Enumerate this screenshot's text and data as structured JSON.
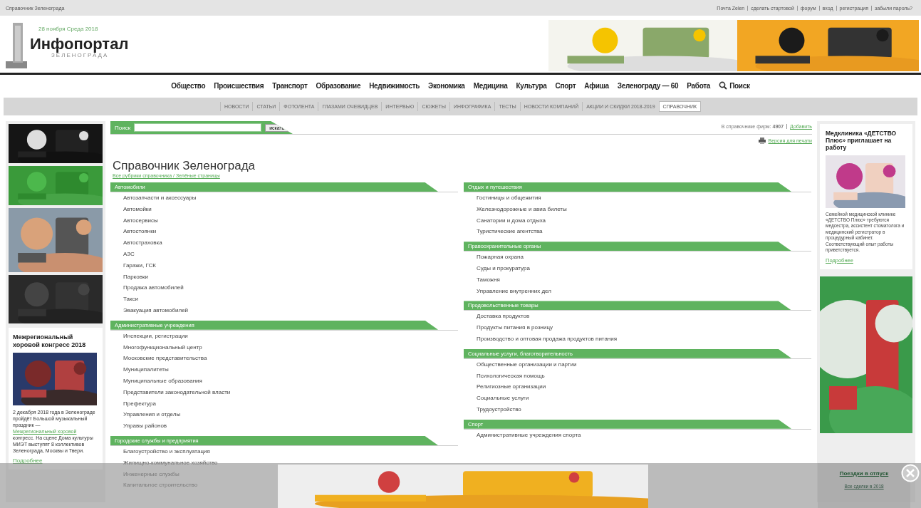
{
  "top_bar": {
    "page_title": "Справочник Зеленограда",
    "links": [
      "Почта Zelen",
      "сделать стартовой",
      "форум",
      "вход",
      "регистрация",
      "забыли пароль?"
    ]
  },
  "header": {
    "date": "28 ноября Среда 2018",
    "logo_title": "Инфопортал",
    "logo_subtitle": "ЗЕЛЕНОГРАДА"
  },
  "main_nav": {
    "items": [
      "Общество",
      "Происшествия",
      "Транспорт",
      "Образование",
      "Недвижимость",
      "Экономика",
      "Медицина",
      "Культура",
      "Спорт",
      "Афиша",
      "Зеленограду — 60",
      "Работа"
    ],
    "search": "Поиск"
  },
  "sub_nav": [
    {
      "label": "НОВОСТИ",
      "selected": false
    },
    {
      "label": "СТАТЬИ",
      "selected": false
    },
    {
      "label": "ФОТОЛЕНТА",
      "selected": false
    },
    {
      "label": "ГЛАЗАМИ ОЧЕВИДЦЕВ",
      "selected": false
    },
    {
      "label": "ИНТЕРВЬЮ",
      "selected": false
    },
    {
      "label": "СЮЖЕТЫ",
      "selected": false
    },
    {
      "label": "ИНФОГРАФИКА",
      "selected": false
    },
    {
      "label": "ТЕСТЫ",
      "selected": false
    },
    {
      "label": "НОВОСТИ КОМПАНИЙ",
      "selected": false
    },
    {
      "label": "АКЦИИ И СКИДКИ 2018-2019",
      "selected": false
    },
    {
      "label": "СПРАВОЧНИК",
      "selected": true
    }
  ],
  "left_sidebar": {
    "news_title": "Межрегиональный хоровой конгресс 2018",
    "news_text": "2 декабря 2018 года в Зеленограде пройдёт Большой музыкальный праздник —",
    "news_link": "Межрегиональный хоровой",
    "news_text_after": "конгресс. На сцене Дома культуры МИЭТ выступят 8 коллективов Зеленограда, Москвы и Твери.",
    "more": "Подробнее"
  },
  "search": {
    "label": "Поиск",
    "button": "искать"
  },
  "stats": {
    "text": "В справочнике фирм: **4907**",
    "add_link": "Добавить",
    "print_link": "Версия для печати"
  },
  "title": "Справочник Зеленограда",
  "breadcrumb": "Все рубрики справочника / Зелёные страницы",
  "columns": [
    [
      {
        "title": "Автомобили",
        "items": [
          "Автозапчасти и аксессуары",
          "Автомойки",
          "Автосервисы",
          "Автостоянки",
          "Автостраховка",
          "АЗС",
          "Гаражи, ГСК",
          "Парковки",
          "Продажа автомобилей",
          "Такси",
          "Эвакуация автомобилей"
        ]
      },
      {
        "title": "Административные учреждения",
        "items": [
          "Инспекции, регистрации",
          "Многофункциональный центр",
          "Московские представительства",
          "Муниципалитеты",
          "Муниципальные образования",
          "Представители законодательной власти",
          "Префектура",
          "Управления и отделы",
          "Управы районов"
        ]
      },
      {
        "title": "Городские службы и предприятия",
        "items": [
          "Благоустройство и эксплуатация",
          "Жилищно-коммунальное хозяйство",
          "Инженерные службы",
          "Капитальное строительство"
        ]
      }
    ],
    [
      {
        "title": "Отдых и путешествия",
        "items": [
          "Гостиницы и общежития",
          "Железнодорожные и авиа билеты",
          "Санатории и дома отдыха",
          "Туристические агентства"
        ]
      },
      {
        "title": "Правоохранительные органы",
        "items": [
          "Пожарная охрана",
          "Суды и прокуратура",
          "Таможня",
          "Управление внутренних дел"
        ]
      },
      {
        "title": "Продовольственные товары",
        "items": [
          "Доставка продуктов",
          "Продукты питания в розницу",
          "Производство и оптовая продажа продуктов питания"
        ]
      },
      {
        "title": "Социальные услуги, благотворительность",
        "items": [
          "Общественные организации и партии",
          "Психологическая помощь",
          "Религиозные организации",
          "Социальные услуги",
          "Трудоустройство"
        ]
      },
      {
        "title": "Спорт",
        "items": [
          "Административные учреждения спорта"
        ]
      }
    ]
  ],
  "right_sidebar": {
    "title": "Медклиника «ДЕТСТВО Плюс» приглашает на работу",
    "text": "Семейной медицинской клинике «ДЕТСТВО Плюс» требуются медсестра, ассистент стоматолога и медицинский регистратор в процедурный кабинет. Соответствующий опыт работы приветствуется.",
    "more": "Подробнее"
  },
  "bottom_bar": {
    "link": "Поездки в отпуск",
    "note": "Все сделки в 2018"
  }
}
